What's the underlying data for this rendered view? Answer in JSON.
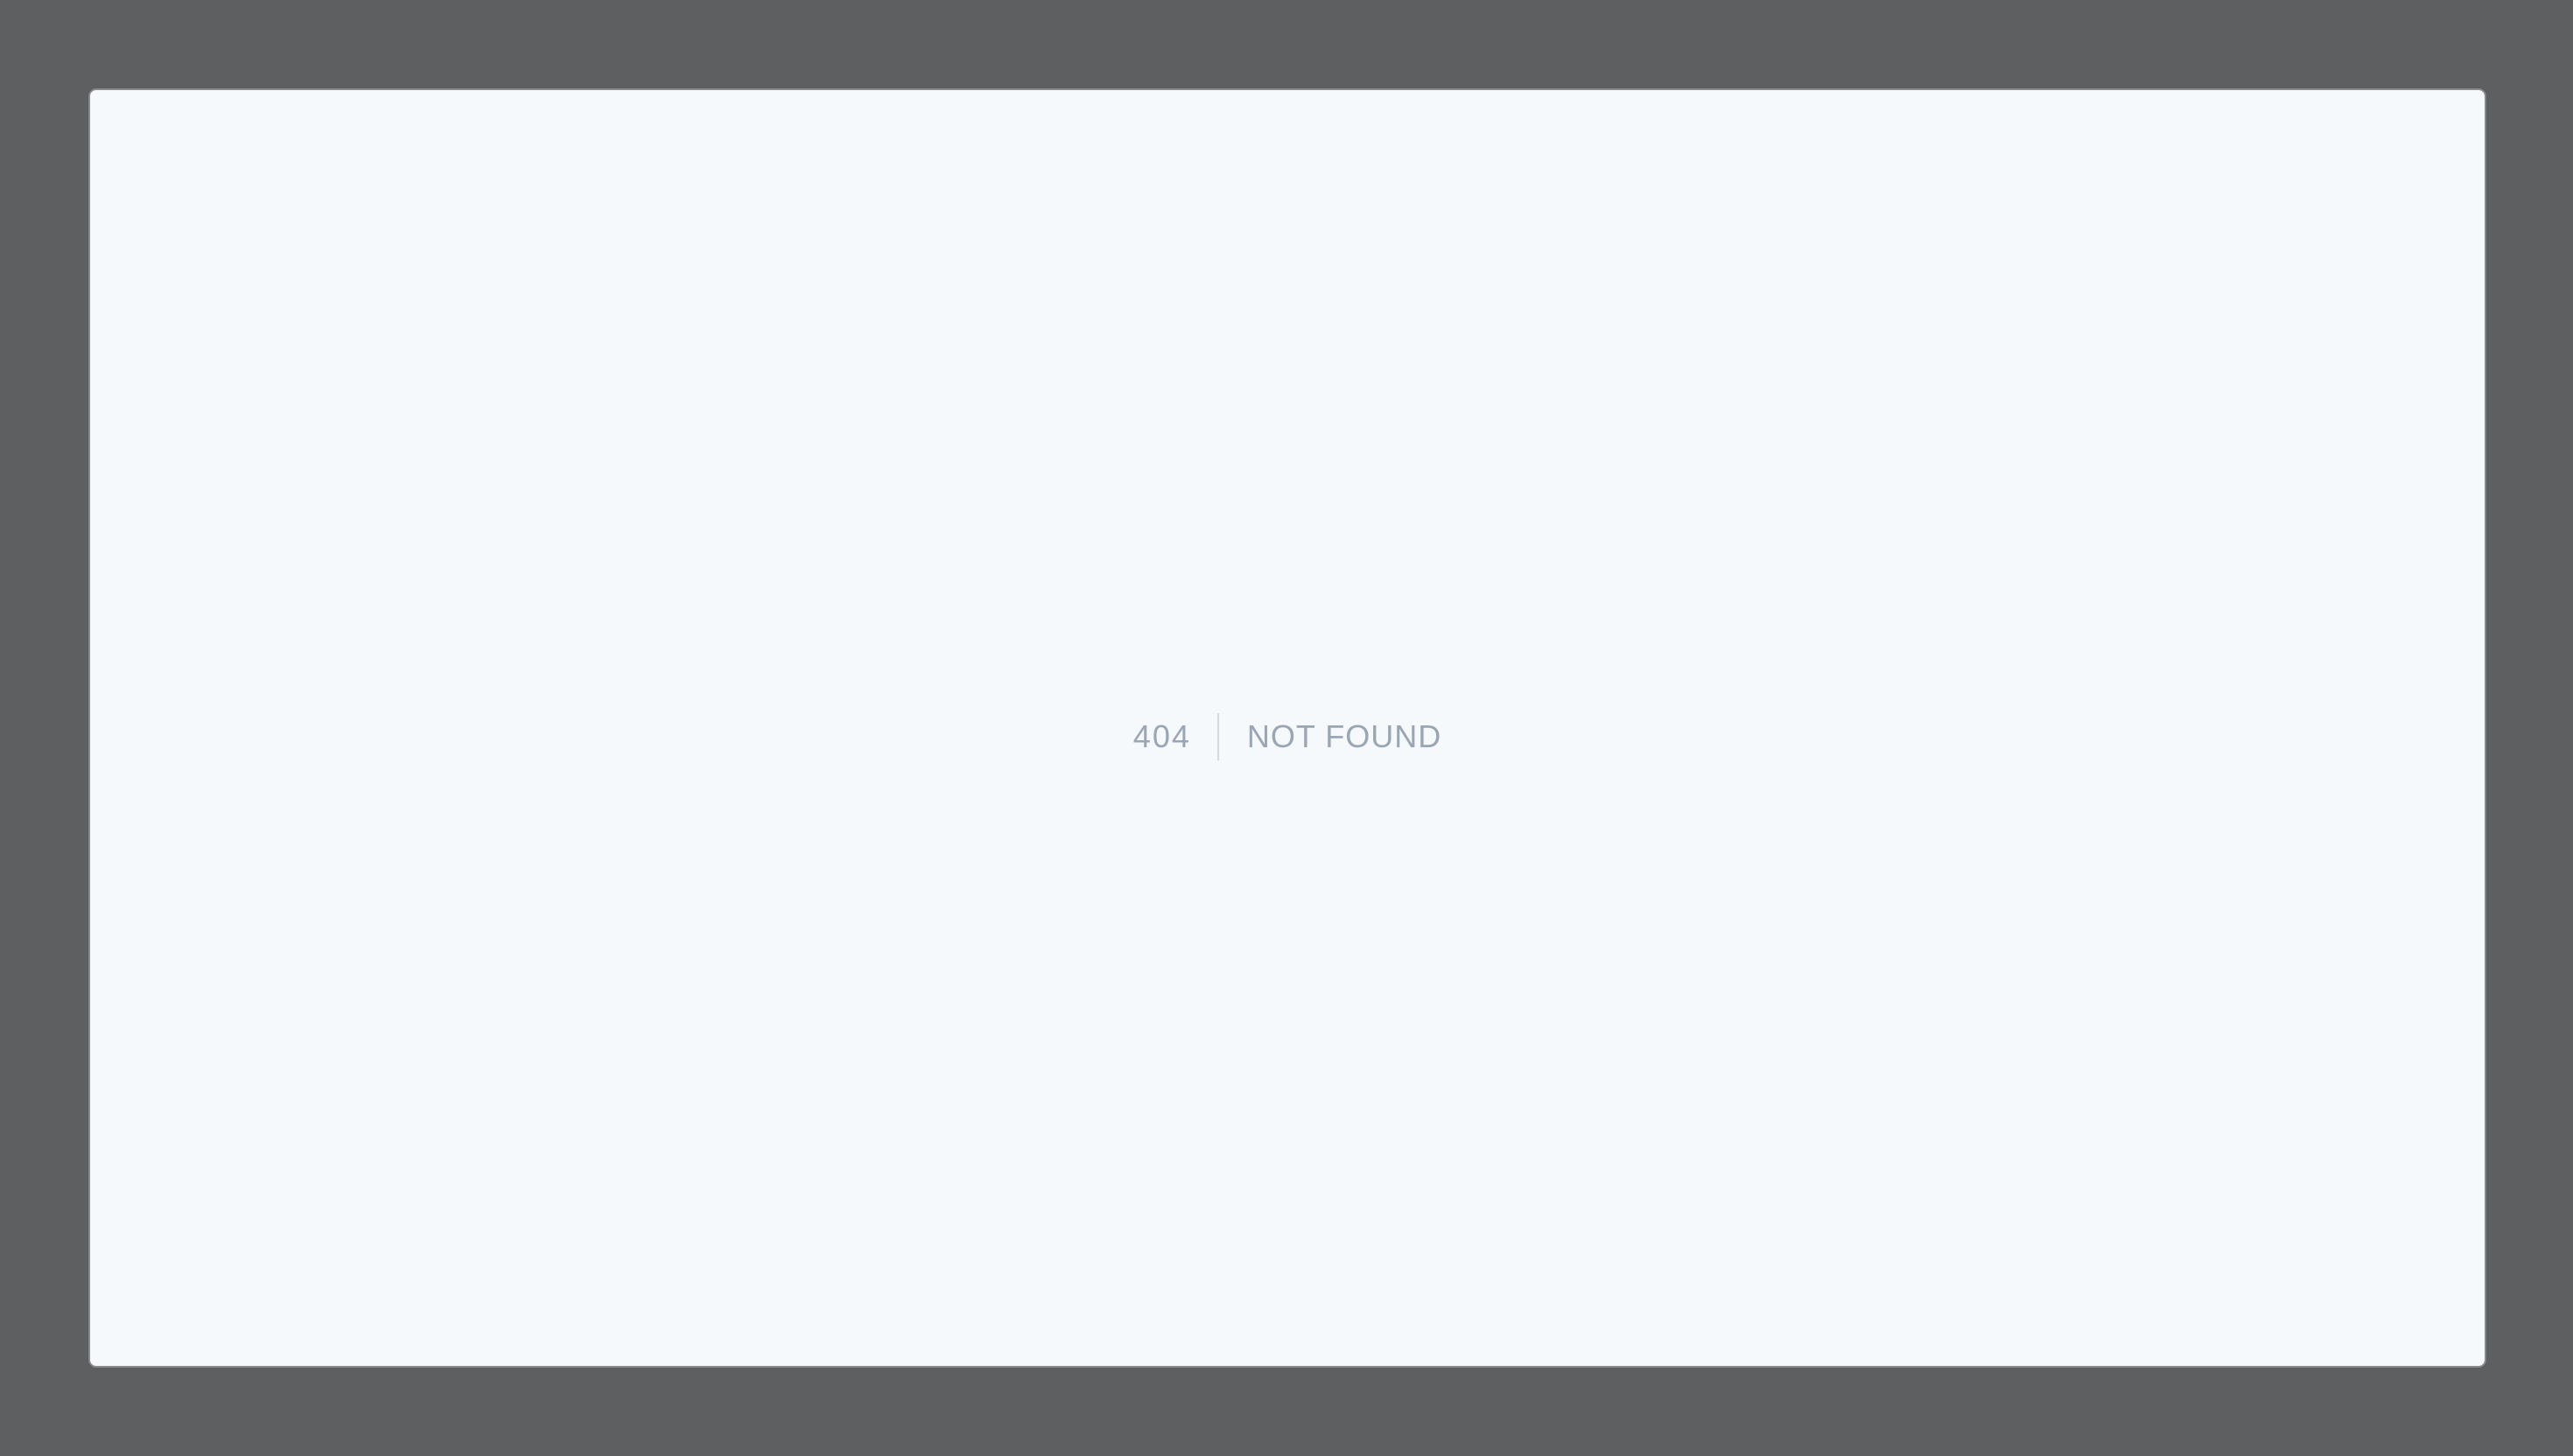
{
  "page": {
    "background_color": "#5e5f61",
    "window_background_color": "#f5f9fc",
    "text_color": "#9aa6b4",
    "divider_color": "#d3d9df"
  },
  "error": {
    "code": "404",
    "message": "NOT FOUND"
  }
}
